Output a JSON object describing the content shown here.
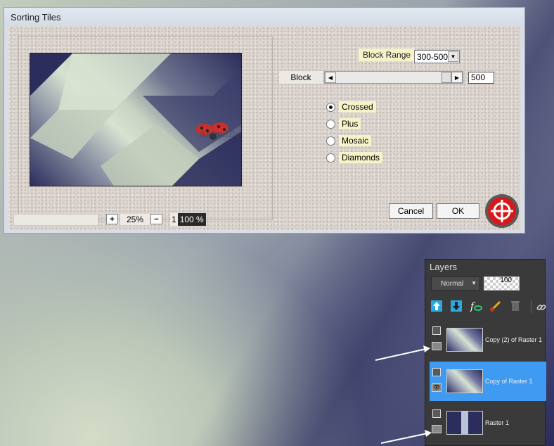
{
  "dialog": {
    "title": "Sorting Tiles",
    "block_range_label": "Block Range",
    "block_range_value": "300-500",
    "block_label": "Block",
    "block_value": "500",
    "block_fraction": 1.0,
    "pattern_options": [
      {
        "label": "Crossed",
        "checked": true
      },
      {
        "label": "Plus",
        "checked": false
      },
      {
        "label": "Mosaic",
        "checked": false
      },
      {
        "label": "Diamonds",
        "checked": false
      }
    ],
    "zoom_plus": "+",
    "zoom_minus": "−",
    "zoom_value": "25%",
    "one_to_one_prefix": "1",
    "one_to_one_highlight": "100 %",
    "cancel_label": "Cancel",
    "ok_label": "OK",
    "preview_watermark": "AnimaBelle"
  },
  "layers_panel": {
    "title": "Layers",
    "blend_mode": "Normal",
    "opacity": "100",
    "tools": [
      "new-layer-icon",
      "move-down-icon",
      "fx-icon",
      "brush-icon",
      "trash-icon",
      "link-icon"
    ],
    "layers": [
      {
        "name": "Copy (2) of Raster 1",
        "selected": false,
        "visible": false
      },
      {
        "name": "Copy of Raster 1",
        "selected": true,
        "visible": true
      },
      {
        "name": "Raster 1",
        "selected": false,
        "visible": false
      }
    ]
  },
  "colors": {
    "accent_selected": "#3f9bf2",
    "label_highlight": "#f6f3c9",
    "logo_red": "#d8171b"
  }
}
